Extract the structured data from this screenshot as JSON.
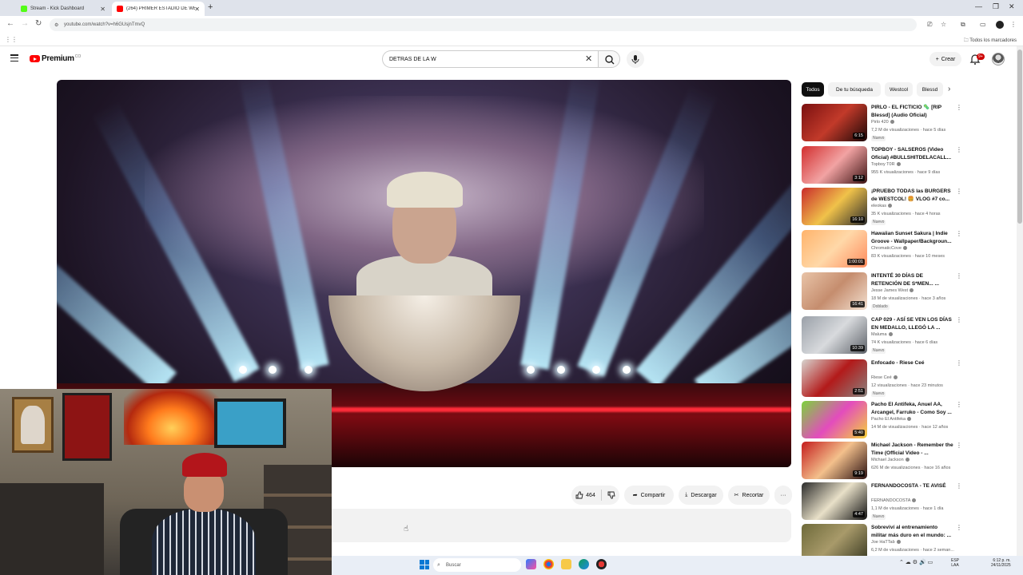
{
  "browser": {
    "tabs": [
      {
        "label": "Stream - Kick Dashboard",
        "icon": "kick-icon",
        "color": "#53fc18"
      },
      {
        "label": "(264) PRIMER ESTADIO DE WE...",
        "icon": "youtube-icon",
        "color": "#ff0000"
      }
    ],
    "url": "youtube.com/watch?v=h6GUsjnTmvQ",
    "bookmarks_all": "Todos los marcadores"
  },
  "youtube": {
    "logo_text": "Premium",
    "logo_country": "CO",
    "search_value": "DETRAS DE LA W",
    "create_label": "Crear",
    "notification_count": "9+"
  },
  "actions": {
    "like_count": "464",
    "share": "Compartir",
    "download": "Descargar",
    "clip": "Recortar"
  },
  "sidebar": {
    "chips": [
      "Todos",
      "De tu búsqueda",
      "Westcol",
      "Blessd"
    ],
    "recommendations": [
      {
        "title": "PIRLO - EL FICTICIO 🦠 [RIP Blessd] (Audio Oficial)",
        "channel": "Pirlo 420",
        "meta": "7,2 M de visualizaciones · hace 5 días",
        "badge": "Nuevo",
        "duration": "6:15",
        "colors": [
          "#7a1010",
          "#c23a2a",
          "#1a0606"
        ]
      },
      {
        "title": "TOPBOY - SALSEROS (Video Oficial) #BULLSHITDELACALL...",
        "channel": "Topboy T0R",
        "meta": "955 K visualizaciones · hace 9 días",
        "badge": "",
        "duration": "3:12",
        "colors": [
          "#d22e2e",
          "#f2a3a3",
          "#3b1212"
        ]
      },
      {
        "title": "¡PRUEBO TODAS las BURGERS de WESTCOL! 🍔 VLOG #7 co...",
        "channel": "eleokas",
        "meta": "35 K visualizaciones · hace 4 horas",
        "badge": "Nuevo",
        "duration": "16:10",
        "colors": [
          "#c92b2b",
          "#f0c24a",
          "#2a2a2a"
        ]
      },
      {
        "title": "Hawaiian Sunset Sakura | Indie Groove - Wallpaper/Backgroun...",
        "channel": "ChromaticCove",
        "meta": "83 K visualizaciones · hace 10 meses",
        "badge": "",
        "duration": "1:00:01",
        "colors": [
          "#ffb36b",
          "#ffd8a8",
          "#ff8a5c"
        ]
      },
      {
        "title": "INTENTÉ 30 DÍAS DE RETENCIÓN DE S*MEN... ...",
        "channel": "Jesse James West",
        "meta": "18 M de visualizaciones · hace 3 años",
        "badge": "Doblado",
        "duration": "16:41",
        "colors": [
          "#e9c4a8",
          "#c58d6e",
          "#f3e0d0"
        ]
      },
      {
        "title": "CAP 029 - ASÍ SE VEN LOS DÍAS EN MEDALLO, LLEGÓ LA ...",
        "channel": "Maluma",
        "meta": "74 K visualizaciones · hace 6 días",
        "badge": "Nuevo",
        "duration": "10:39",
        "colors": [
          "#9aa0a8",
          "#d8dadd",
          "#5c6168"
        ]
      },
      {
        "title": "Enfocado - Riese Ceé",
        "channel": "Riese Ceé",
        "meta": "12 visualizaciones · hace 23 minutos",
        "badge": "Nuevo",
        "duration": "2:51",
        "colors": [
          "#d8d4cf",
          "#b31a1a",
          "#8a8480"
        ]
      },
      {
        "title": "Pacho El Antifeka, Anuel AA, Arcangel, Farruko - Como Soy ...",
        "channel": "Pacho El Antifeka",
        "meta": "14 M de visualizaciones · hace 12 años",
        "badge": "",
        "duration": "5:40",
        "colors": [
          "#7bd43b",
          "#e34cbd",
          "#f4d23a"
        ]
      },
      {
        "title": "Michael Jackson - Remember the Time (Official Video - ...",
        "channel": "Michael Jackson",
        "meta": "626 M de visualizaciones · hace 16 años",
        "badge": "",
        "duration": "9:19",
        "colors": [
          "#c41d1d",
          "#f3c08c",
          "#2a1010"
        ]
      },
      {
        "title": "FERNANDOCOSTA - TE AVISÉ",
        "channel": "FERNANDOCOSTA",
        "meta": "1,1 M de visualizaciones · hace 1 día",
        "badge": "Nuevo",
        "duration": "4:47",
        "colors": [
          "#2a2a2a",
          "#e8e0c8",
          "#111111"
        ]
      },
      {
        "title": "Sobreviví al entrenamiento militar más duro en el mundo: ...",
        "channel": "Joe HaTTab",
        "meta": "6,2 M de visualizaciones · hace 2 seman...",
        "badge": "",
        "duration": "",
        "colors": [
          "#6e6a3a",
          "#a89a6a",
          "#3a3a22"
        ]
      }
    ]
  },
  "taskbar": {
    "search_placeholder": "Buscar",
    "lang_line1": "ESP",
    "lang_line2": "LAA",
    "time": "6:12 p. m.",
    "date": "24/11/2025"
  }
}
